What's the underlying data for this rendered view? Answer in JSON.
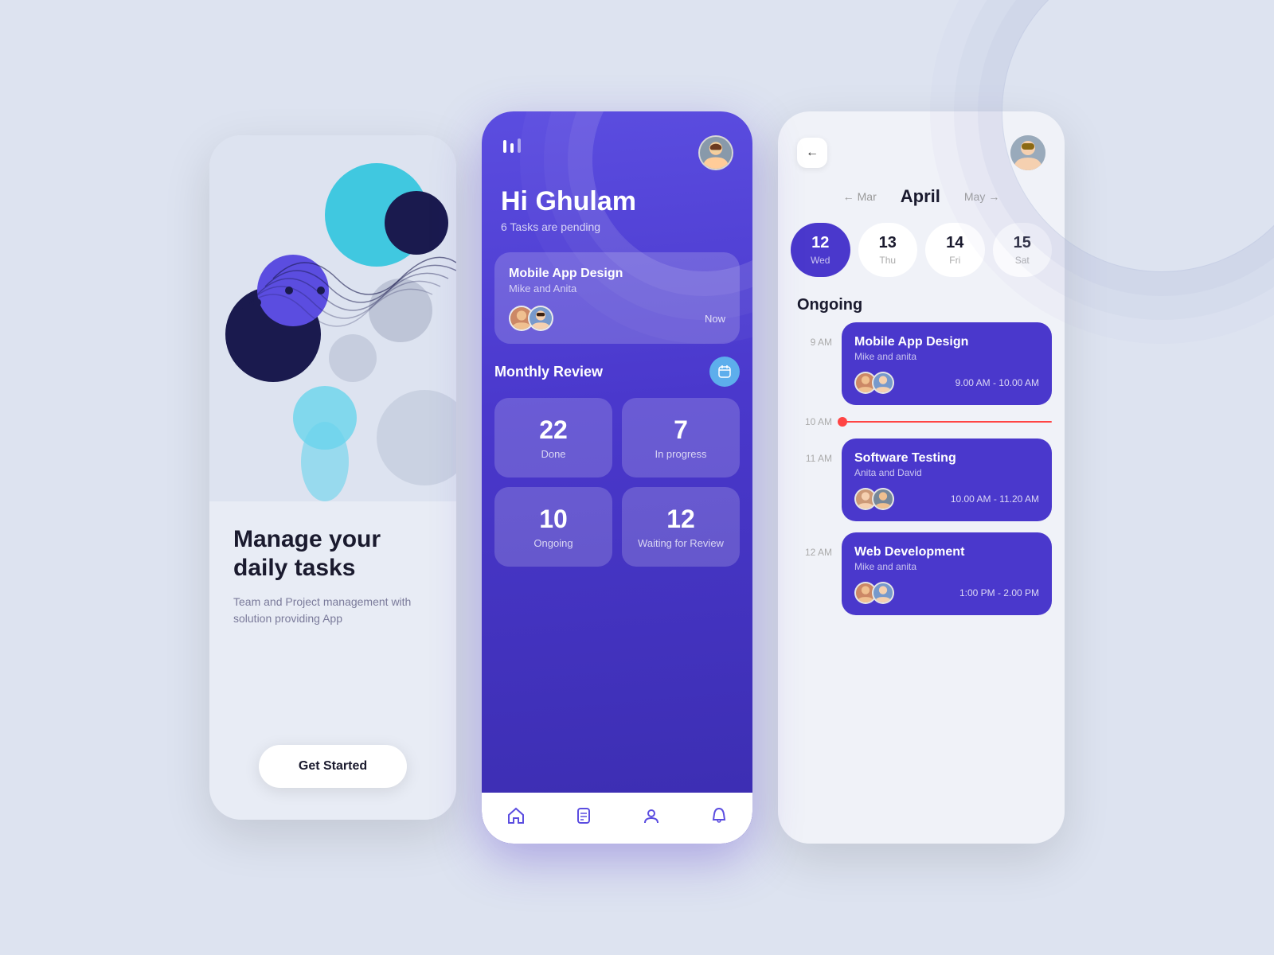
{
  "background": "#dde3f0",
  "card1": {
    "title": "Manage your daily tasks",
    "subtitle": "Team and Project management with solution providing App",
    "btn_label": "Get Started"
  },
  "card2": {
    "logo": "▐║",
    "greeting": "Hi Ghulam",
    "tasks_pending": "6 Tasks are pending",
    "task_title": "Mobile App Design",
    "task_members": "Mike and Anita",
    "task_time": "Now",
    "monthly_review": "Monthly Review",
    "stats": [
      {
        "number": "22",
        "label": "Done"
      },
      {
        "number": "7",
        "label": "In progress"
      },
      {
        "number": "10",
        "label": "Ongoing"
      },
      {
        "number": "12",
        "label": "Waiting for Review"
      }
    ],
    "nav_icons": [
      "home",
      "file",
      "user",
      "bell"
    ]
  },
  "card3": {
    "month": "April",
    "prev_month": "Mar",
    "next_month": "May",
    "dates": [
      {
        "num": "12",
        "day": "Wed",
        "active": true
      },
      {
        "num": "13",
        "day": "Thu",
        "active": false
      },
      {
        "num": "14",
        "day": "Fri",
        "active": false
      },
      {
        "num": "15",
        "day": "Sat",
        "active": false
      }
    ],
    "ongoing_label": "Ongoing",
    "events": [
      {
        "time": "9 AM",
        "title": "Mobile App Design",
        "members": "Mike and anita",
        "time_range": "9.00 AM - 10.00 AM"
      },
      {
        "time": "10 AM",
        "is_line": true
      },
      {
        "time": "11 AM",
        "title": "Software Testing",
        "members": "Anita and David",
        "time_range": "10.00 AM - 11.20 AM"
      },
      {
        "time": "12 AM",
        "title": "Web Development",
        "members": "Mike and anita",
        "time_range": "1:00 PM - 2.00 PM"
      }
    ]
  }
}
